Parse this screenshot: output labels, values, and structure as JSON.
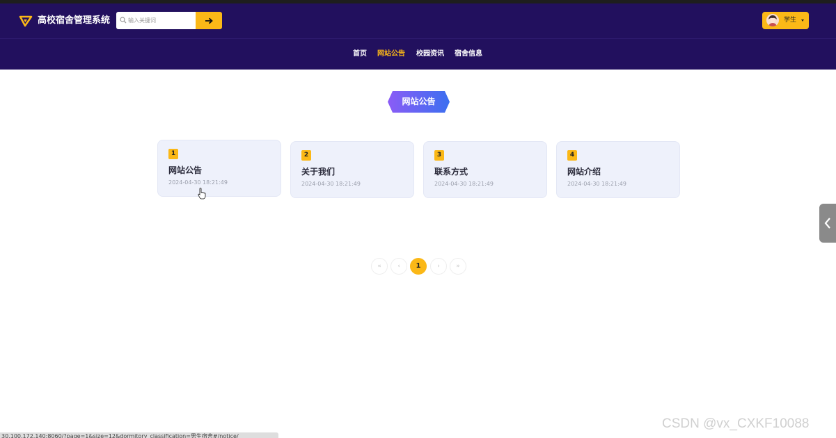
{
  "header": {
    "site_title": "高校宿舍管理系统",
    "search": {
      "placeholder": "输入关键词",
      "button_icon": "arrow-right-icon"
    },
    "user_menu": {
      "label": "学生",
      "avatar": "avatar"
    }
  },
  "nav": {
    "items": [
      {
        "label": "首页"
      },
      {
        "label": "网站公告",
        "active": true
      },
      {
        "label": "校园资讯"
      },
      {
        "label": "宿舍信息"
      }
    ]
  },
  "section": {
    "title": "网站公告"
  },
  "notices": [
    {
      "index": "1",
      "title": "网站公告",
      "date": "2024-04-30 18:21:49"
    },
    {
      "index": "2",
      "title": "关于我们",
      "date": "2024-04-30 18:21:49"
    },
    {
      "index": "3",
      "title": "联系方式",
      "date": "2024-04-30 18:21:49"
    },
    {
      "index": "4",
      "title": "网站介绍",
      "date": "2024-04-30 18:21:49"
    }
  ],
  "pagination": {
    "first": "«",
    "prev": "‹",
    "current": "1",
    "next": "›",
    "last": "»"
  },
  "status_bar": {
    "url": "30.100.172.140:8060/?page=1&size=12&dormitory_classification=男生宿舍#/notice/"
  },
  "watermark": "CSDN @vx_CXKF10088",
  "colors": {
    "header_bg": "#22105e",
    "accent": "#fbb817",
    "card_bg": "#eef1fb",
    "badge_gradient": [
      "#8b5cf6",
      "#3b6ff0"
    ]
  }
}
